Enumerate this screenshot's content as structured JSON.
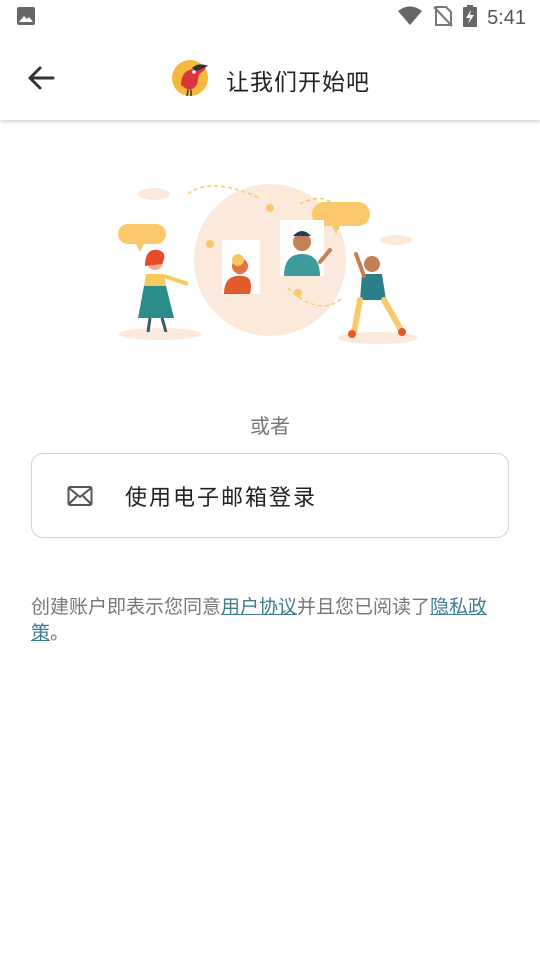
{
  "status_bar": {
    "time": "5:41",
    "icons": [
      "image-icon",
      "wifi-icon",
      "no-sim-icon",
      "battery-charging-icon"
    ]
  },
  "app_bar": {
    "back_icon": "arrow-back-icon",
    "logo": "toucan-logo-icon",
    "title": "让我们开始吧"
  },
  "main": {
    "illustration": "people-waving-illustration",
    "or_label": "或者",
    "email_button": {
      "icon": "mail-icon",
      "label": "使用电子邮箱登录"
    },
    "terms": {
      "prefix": "创建账户即表示您同意",
      "user_agreement": "用户协议",
      "middle": "并且您已阅读了",
      "privacy_policy": "隐私政策",
      "suffix": "。"
    }
  },
  "colors": {
    "link": "#3f7e90",
    "accent_yellow": "#fbc96b",
    "illustration_bg": "#fbe9db",
    "border": "#d2d2d2"
  }
}
